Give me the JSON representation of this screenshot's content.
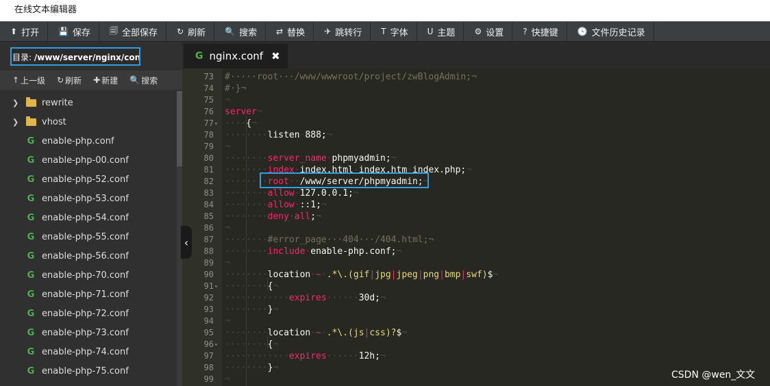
{
  "window_title": "在线文本编辑器",
  "toolbar": [
    {
      "icon": "upload-icon",
      "glyph": "⬆",
      "label": "打开"
    },
    {
      "icon": "save-icon",
      "glyph": "💾",
      "label": "保存"
    },
    {
      "icon": "save-all-icon",
      "glyph": "🗐",
      "label": "全部保存"
    },
    {
      "icon": "refresh-icon",
      "glyph": "↻",
      "label": "刷新"
    },
    {
      "icon": "search-icon",
      "glyph": "🔍",
      "label": "搜索"
    },
    {
      "icon": "replace-icon",
      "glyph": "⇄",
      "label": "替换"
    },
    {
      "icon": "goto-line-icon",
      "glyph": "✈",
      "label": "跳转行"
    },
    {
      "icon": "font-icon",
      "glyph": "T",
      "label": "字体"
    },
    {
      "icon": "theme-icon",
      "glyph": "U",
      "label": "主题"
    },
    {
      "icon": "gear-icon",
      "glyph": "⚙",
      "label": "设置"
    },
    {
      "icon": "help-icon",
      "glyph": "?",
      "label": "快捷键"
    },
    {
      "icon": "history-icon",
      "glyph": "🕓",
      "label": "文件历史记录"
    }
  ],
  "sidebar": {
    "directory_label": "目录:",
    "directory_path": "/www/server/nginx/conf",
    "tools": [
      {
        "icon": "arrow-up-icon",
        "glyph": "↑",
        "label": "上一级"
      },
      {
        "icon": "refresh-icon",
        "glyph": "↻",
        "label": "刷新"
      },
      {
        "icon": "plus-icon",
        "glyph": "✚",
        "label": "新建"
      },
      {
        "icon": "search-icon",
        "glyph": "🔍",
        "label": "搜索"
      }
    ],
    "files": [
      {
        "type": "folder",
        "name": "rewrite"
      },
      {
        "type": "folder",
        "name": "vhost"
      },
      {
        "type": "file",
        "name": "enable-php.conf"
      },
      {
        "type": "file",
        "name": "enable-php-00.conf"
      },
      {
        "type": "file",
        "name": "enable-php-52.conf"
      },
      {
        "type": "file",
        "name": "enable-php-53.conf"
      },
      {
        "type": "file",
        "name": "enable-php-54.conf"
      },
      {
        "type": "file",
        "name": "enable-php-55.conf"
      },
      {
        "type": "file",
        "name": "enable-php-56.conf"
      },
      {
        "type": "file",
        "name": "enable-php-70.conf"
      },
      {
        "type": "file",
        "name": "enable-php-71.conf"
      },
      {
        "type": "file",
        "name": "enable-php-72.conf"
      },
      {
        "type": "file",
        "name": "enable-php-73.conf"
      },
      {
        "type": "file",
        "name": "enable-php-74.conf"
      },
      {
        "type": "file",
        "name": "enable-php-75.conf"
      }
    ]
  },
  "tab": {
    "icon": "nginx-icon",
    "name": "nginx.conf"
  },
  "code_lines": [
    {
      "n": "73",
      "fold": "",
      "segs": [
        [
          "cm",
          "#·····root···/www/wwwroot/project/zwBlogAdmin;¬"
        ]
      ]
    },
    {
      "n": "74",
      "fold": "",
      "segs": [
        [
          "cm",
          "#·}¬"
        ]
      ]
    },
    {
      "n": "75",
      "fold": "",
      "segs": [
        [
          "inv",
          "¬"
        ]
      ]
    },
    {
      "n": "76",
      "fold": "",
      "segs": [
        [
          "kw",
          "server"
        ],
        [
          "inv",
          "¬"
        ]
      ]
    },
    {
      "n": "77",
      "fold": "▾",
      "segs": [
        [
          "inv",
          "····"
        ],
        [
          "pl",
          "{"
        ],
        [
          "inv",
          "¬"
        ]
      ]
    },
    {
      "n": "78",
      "fold": "",
      "segs": [
        [
          "inv",
          "········"
        ],
        [
          "pl",
          "listen"
        ],
        [
          "inv",
          "·"
        ],
        [
          "pl",
          "888;"
        ],
        [
          "inv",
          "¬"
        ]
      ]
    },
    {
      "n": "79",
      "fold": "",
      "segs": [
        [
          "inv",
          "¬"
        ]
      ]
    },
    {
      "n": "80",
      "fold": "",
      "segs": [
        [
          "inv",
          "········"
        ],
        [
          "kw",
          "server_name"
        ],
        [
          "inv",
          "·"
        ],
        [
          "pl",
          "phpmyadmin;"
        ],
        [
          "inv",
          "¬"
        ]
      ]
    },
    {
      "n": "81",
      "fold": "",
      "segs": [
        [
          "inv",
          "········"
        ],
        [
          "kw",
          "index"
        ],
        [
          "inv",
          "·"
        ],
        [
          "pl",
          "index.html"
        ],
        [
          "inv",
          "·"
        ],
        [
          "pl",
          "index.htm"
        ],
        [
          "inv",
          "·"
        ],
        [
          "pl",
          "index.php;"
        ],
        [
          "inv",
          "¬"
        ]
      ]
    },
    {
      "n": "82",
      "fold": "",
      "segs": [
        [
          "inv",
          "········"
        ],
        [
          "kw",
          "root"
        ],
        [
          "inv",
          "··"
        ],
        [
          "pl",
          "/www/server/phpmyadmin;"
        ],
        [
          "inv",
          "¬"
        ]
      ]
    },
    {
      "n": "83",
      "fold": "",
      "segs": [
        [
          "inv",
          "········"
        ],
        [
          "kw",
          "allow"
        ],
        [
          "inv",
          "·"
        ],
        [
          "pl",
          "127.0.0.1;"
        ],
        [
          "inv",
          "¬"
        ]
      ]
    },
    {
      "n": "84",
      "fold": "",
      "segs": [
        [
          "inv",
          "········"
        ],
        [
          "kw",
          "allow"
        ],
        [
          "inv",
          "·"
        ],
        [
          "pl",
          "::1;"
        ],
        [
          "inv",
          "¬"
        ]
      ]
    },
    {
      "n": "85",
      "fold": "",
      "segs": [
        [
          "inv",
          "········"
        ],
        [
          "kw",
          "deny"
        ],
        [
          "inv",
          "·"
        ],
        [
          "kw",
          "all"
        ],
        [
          "pl",
          ";"
        ],
        [
          "inv",
          "¬"
        ]
      ]
    },
    {
      "n": "86",
      "fold": "",
      "segs": [
        [
          "inv",
          "¬"
        ]
      ]
    },
    {
      "n": "87",
      "fold": "",
      "segs": [
        [
          "inv",
          "········"
        ],
        [
          "cm",
          "#error_page···404···/404.html;¬"
        ]
      ]
    },
    {
      "n": "88",
      "fold": "",
      "segs": [
        [
          "inv",
          "········"
        ],
        [
          "kw",
          "include"
        ],
        [
          "inv",
          "·"
        ],
        [
          "pl",
          "enable-php.conf;"
        ],
        [
          "inv",
          "¬"
        ]
      ]
    },
    {
      "n": "89",
      "fold": "",
      "segs": [
        [
          "inv",
          "¬"
        ]
      ]
    },
    {
      "n": "90",
      "fold": "",
      "segs": [
        [
          "inv",
          "········"
        ],
        [
          "pl",
          "location"
        ],
        [
          "inv",
          "·"
        ],
        [
          "kw",
          "~"
        ],
        [
          "inv",
          "·"
        ],
        [
          "rx",
          ".*\\.(gif"
        ],
        [
          "kw",
          "|"
        ],
        [
          "rx",
          "jpg"
        ],
        [
          "kw",
          "|"
        ],
        [
          "rx",
          "jpeg"
        ],
        [
          "kw",
          "|"
        ],
        [
          "rx",
          "png"
        ],
        [
          "kw",
          "|"
        ],
        [
          "rx",
          "bmp"
        ],
        [
          "kw",
          "|"
        ],
        [
          "rx",
          "swf)"
        ],
        [
          "pl",
          "$"
        ],
        [
          "inv",
          "¬"
        ]
      ]
    },
    {
      "n": "91",
      "fold": "▾",
      "segs": [
        [
          "inv",
          "········"
        ],
        [
          "pl",
          "{"
        ],
        [
          "inv",
          "¬"
        ]
      ]
    },
    {
      "n": "92",
      "fold": "",
      "segs": [
        [
          "inv",
          "············"
        ],
        [
          "kw",
          "expires"
        ],
        [
          "inv",
          "······"
        ],
        [
          "pl",
          "30d;"
        ],
        [
          "inv",
          "¬"
        ]
      ]
    },
    {
      "n": "93",
      "fold": "",
      "segs": [
        [
          "inv",
          "········"
        ],
        [
          "pl",
          "}"
        ],
        [
          "inv",
          "¬"
        ]
      ]
    },
    {
      "n": "94",
      "fold": "",
      "segs": [
        [
          "inv",
          "¬"
        ]
      ]
    },
    {
      "n": "95",
      "fold": "",
      "segs": [
        [
          "inv",
          "········"
        ],
        [
          "pl",
          "location"
        ],
        [
          "inv",
          "·"
        ],
        [
          "kw",
          "~"
        ],
        [
          "inv",
          "·"
        ],
        [
          "rx",
          ".*\\.(js"
        ],
        [
          "kw",
          "|"
        ],
        [
          "rx",
          "css)?"
        ],
        [
          "pl",
          "$"
        ],
        [
          "inv",
          "¬"
        ]
      ]
    },
    {
      "n": "96",
      "fold": "▾",
      "segs": [
        [
          "inv",
          "········"
        ],
        [
          "pl",
          "{"
        ],
        [
          "inv",
          "¬"
        ]
      ]
    },
    {
      "n": "97",
      "fold": "",
      "segs": [
        [
          "inv",
          "············"
        ],
        [
          "kw",
          "expires"
        ],
        [
          "inv",
          "······"
        ],
        [
          "pl",
          "12h;"
        ],
        [
          "inv",
          "¬"
        ]
      ]
    },
    {
      "n": "98",
      "fold": "",
      "segs": [
        [
          "inv",
          "········"
        ],
        [
          "pl",
          "}"
        ],
        [
          "inv",
          "¬"
        ]
      ]
    },
    {
      "n": "99",
      "fold": "",
      "segs": [
        [
          "inv",
          "¬"
        ]
      ]
    }
  ],
  "watermark": "CSDN @wen_文文"
}
